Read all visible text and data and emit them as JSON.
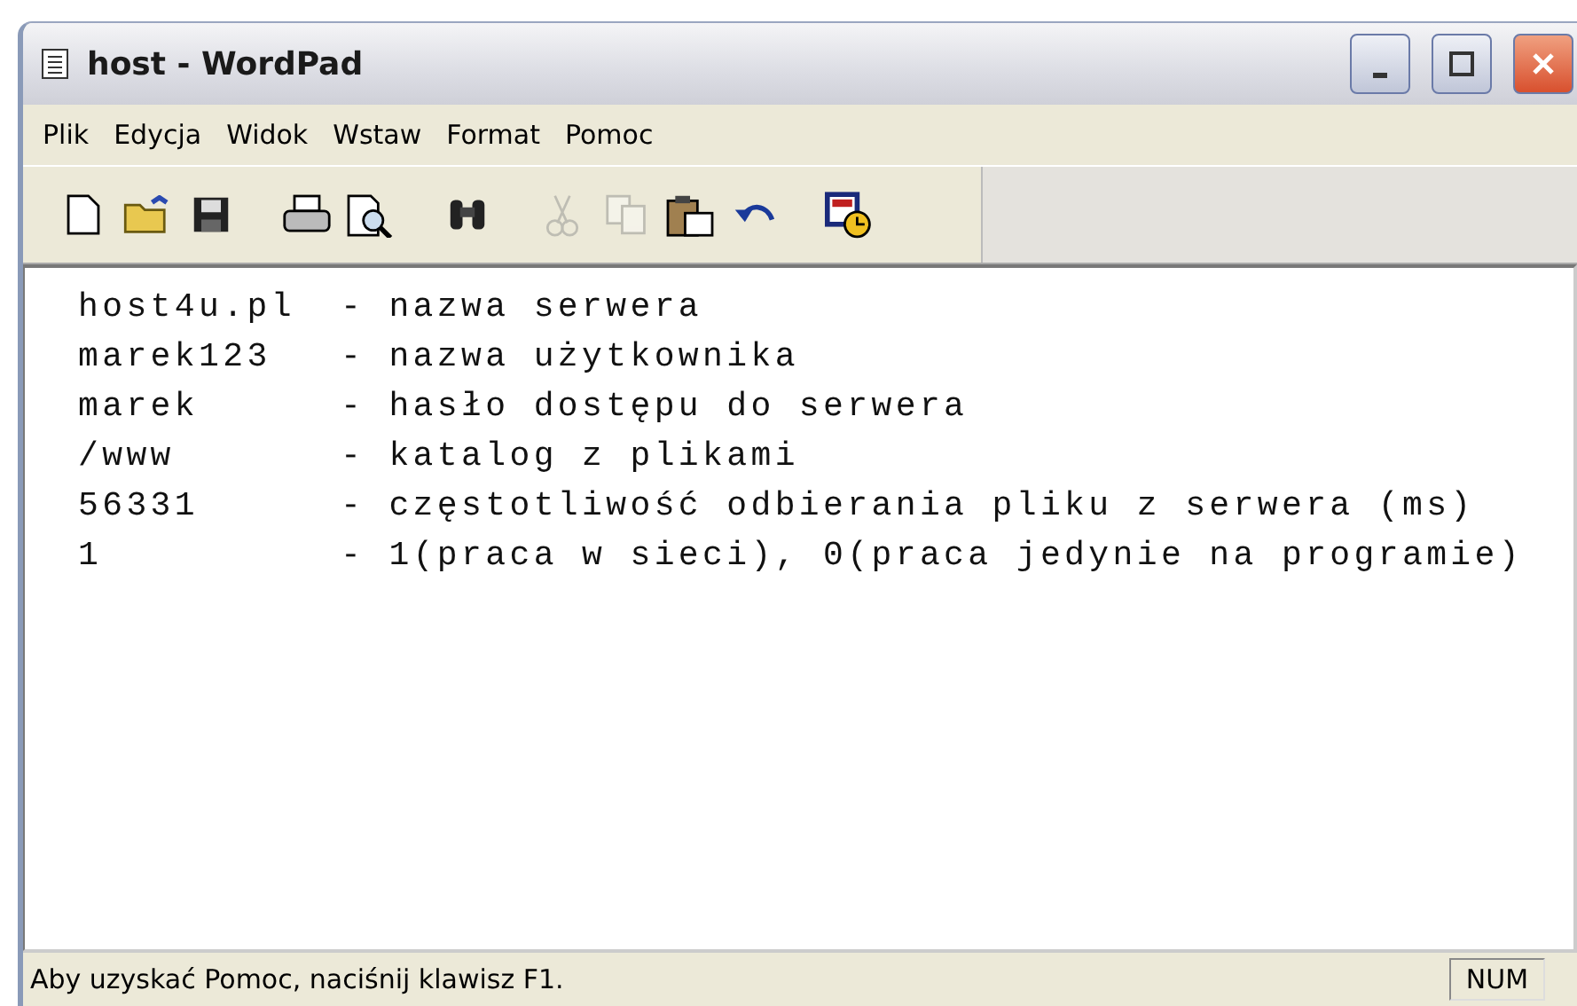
{
  "window": {
    "title": "host - WordPad"
  },
  "menu": [
    "Plik",
    "Edycja",
    "Widok",
    "Wstaw",
    "Format",
    "Pomoc"
  ],
  "toolbar": [
    {
      "kind": "new",
      "disabled": false
    },
    {
      "kind": "open",
      "disabled": false
    },
    {
      "kind": "save",
      "disabled": false
    },
    {
      "kind": "sep"
    },
    {
      "kind": "print",
      "disabled": false
    },
    {
      "kind": "preview",
      "disabled": false
    },
    {
      "kind": "sep"
    },
    {
      "kind": "find",
      "disabled": false
    },
    {
      "kind": "sep"
    },
    {
      "kind": "cut",
      "disabled": true
    },
    {
      "kind": "copy",
      "disabled": true
    },
    {
      "kind": "paste",
      "disabled": false
    },
    {
      "kind": "undo",
      "disabled": false
    },
    {
      "kind": "sep"
    },
    {
      "kind": "datetime",
      "disabled": false
    }
  ],
  "document": {
    "lines": [
      {
        "key": "host4u.pl",
        "description": "- nazwa serwera"
      },
      {
        "key": "marek123",
        "description": "- nazwa użytkownika"
      },
      {
        "key": "marek",
        "description": "- hasło dostępu do serwera"
      },
      {
        "key": "/www",
        "description": "- katalog z plikami"
      },
      {
        "key": "56331",
        "description": "- częstotliwość odbierania pliku z serwera (ms)"
      },
      {
        "key": "1",
        "description": "- 1(praca w sieci), 0(praca jedynie na programie)"
      }
    ]
  },
  "status_bar": {
    "message": "Aby uzyskać Pomoc, naciśnij klawisz F1.",
    "indicator": "NUM"
  }
}
